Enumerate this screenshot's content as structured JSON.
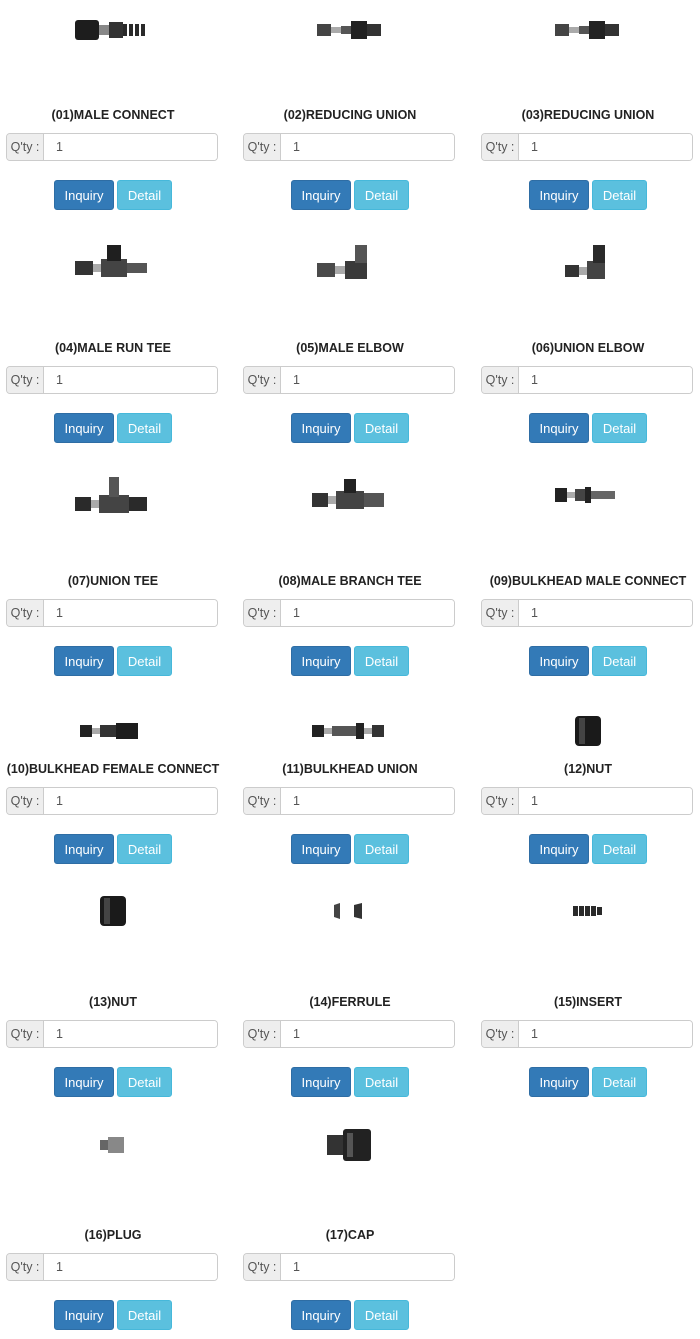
{
  "qty_label": "Q'ty :",
  "inquiry_label": "Inquiry",
  "detail_label": "Detail",
  "products": [
    {
      "title": "(01)MALE CONNECT",
      "qty": "1",
      "icon": "male-connect-fitting-icon"
    },
    {
      "title": "(02)REDUCING UNION",
      "qty": "1",
      "icon": "reducing-union-fitting-icon"
    },
    {
      "title": "(03)REDUCING UNION",
      "qty": "1",
      "icon": "reducing-union-fitting-icon"
    },
    {
      "title": "(04)MALE RUN TEE",
      "qty": "1",
      "icon": "male-run-tee-fitting-icon"
    },
    {
      "title": "(05)MALE ELBOW",
      "qty": "1",
      "icon": "male-elbow-fitting-icon"
    },
    {
      "title": "(06)UNION ELBOW",
      "qty": "1",
      "icon": "union-elbow-fitting-icon"
    },
    {
      "title": "(07)UNION TEE",
      "qty": "1",
      "icon": "union-tee-fitting-icon"
    },
    {
      "title": "(08)MALE BRANCH TEE",
      "qty": "1",
      "icon": "male-branch-tee-fitting-icon"
    },
    {
      "title": "(09)BULKHEAD MALE CONNECT",
      "qty": "1",
      "icon": "bulkhead-male-connect-fitting-icon"
    },
    {
      "title": "(10)BULKHEAD FEMALE CONNECT",
      "qty": "1",
      "icon": "bulkhead-female-connect-fitting-icon"
    },
    {
      "title": "(11)BULKHEAD UNION",
      "qty": "1",
      "icon": "bulkhead-union-fitting-icon"
    },
    {
      "title": "(12)NUT",
      "qty": "1",
      "icon": "nut-icon"
    },
    {
      "title": "(13)NUT",
      "qty": "1",
      "icon": "nut-icon"
    },
    {
      "title": "(14)FERRULE",
      "qty": "1",
      "icon": "ferrule-icon"
    },
    {
      "title": "(15)INSERT",
      "qty": "1",
      "icon": "insert-icon"
    },
    {
      "title": "(16)PLUG",
      "qty": "1",
      "icon": "plug-icon"
    },
    {
      "title": "(17)CAP",
      "qty": "1",
      "icon": "cap-icon"
    }
  ]
}
